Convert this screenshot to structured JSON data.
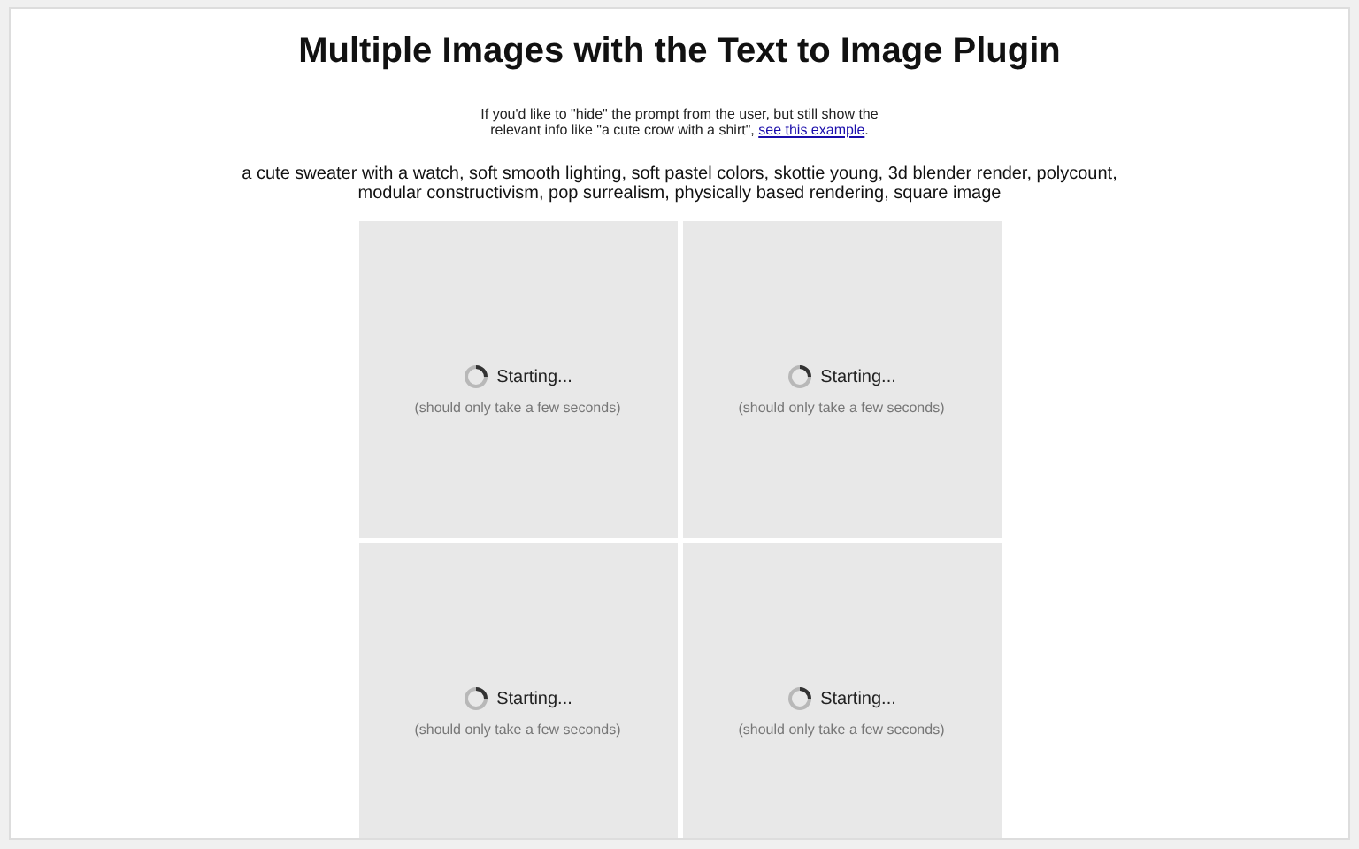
{
  "title": "Multiple Images with the Text to Image Plugin",
  "intro": {
    "text": "If you'd like to \"hide\" the prompt from the user, but still show the relevant info like \"a cute crow with a shirt\",",
    "link": "see this example",
    "after": "."
  },
  "prompt": "a cute sweater with a watch, soft smooth lighting, soft pastel colors, skottie young, 3d blender render, polycount, modular constructivism, pop surrealism, physically based rendering, square image",
  "tiles": [
    {
      "status": "Starting...",
      "note": "(should only take a few seconds)"
    },
    {
      "status": "Starting...",
      "note": "(should only take a few seconds)"
    },
    {
      "status": "Starting...",
      "note": "(should only take a few seconds)"
    },
    {
      "status": "Starting...",
      "note": "(should only take a few seconds)"
    }
  ]
}
